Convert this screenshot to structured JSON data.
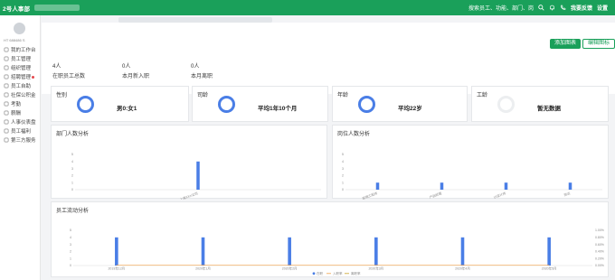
{
  "header": {
    "logo": "2号人事部",
    "search_text": "搜索员工、功能、部门、岗",
    "feedback": "我要反馈",
    "settings": "设置"
  },
  "sidebar": {
    "user_caption": "HT 688486 S",
    "items": [
      {
        "label": "我的工作台",
        "icon": "desk-icon"
      },
      {
        "label": "员工管理",
        "icon": "employee-icon"
      },
      {
        "label": "组织管理",
        "icon": "org-icon"
      },
      {
        "label": "招聘管理",
        "icon": "recruit-icon",
        "badge": true
      },
      {
        "label": "员工自助",
        "icon": "self-service-icon"
      },
      {
        "label": "社保公积金",
        "icon": "social-security-icon"
      },
      {
        "label": "考勤",
        "icon": "attendance-icon"
      },
      {
        "label": "薪酬",
        "icon": "salary-icon"
      },
      {
        "label": "人事仪表盘",
        "icon": "dashboard-icon"
      },
      {
        "label": "员工福利",
        "icon": "benefit-icon"
      },
      {
        "label": "第三方服务",
        "icon": "third-party-icon"
      }
    ]
  },
  "stats": [
    {
      "value": "4人",
      "label": "在职员工总数"
    },
    {
      "value": "0人",
      "label": "本月新入职"
    },
    {
      "value": "0人",
      "label": "本月离职"
    }
  ],
  "actions": {
    "add_chart": "添加图表",
    "edit_chart": "编辑图标"
  },
  "summary_cards": [
    {
      "title": "性别",
      "value": "男0:女1",
      "ring": "filled"
    },
    {
      "title": "司龄",
      "value": "平均1年10个月",
      "ring": "filled"
    },
    {
      "title": "年龄",
      "value": "平均22岁",
      "ring": "filled"
    },
    {
      "title": "工龄",
      "value": "暂无数据",
      "ring": "empty"
    }
  ],
  "colors": {
    "brand": "#1aa05a",
    "bar": "#4a7ee6",
    "line": "#f0a14a",
    "ring_empty": "#eceef0"
  },
  "chart_data": [
    {
      "type": "bar",
      "title": "部门人数分析",
      "categories": [
        "上海XXX公司"
      ],
      "values": [
        4
      ],
      "ylim": [
        0,
        5
      ],
      "yticks": [
        "0",
        "1",
        "2",
        "3",
        "4",
        "5"
      ],
      "grid": false
    },
    {
      "type": "bar",
      "title": "岗位人数分析",
      "categories": [
        "前端工程师",
        "产品经理",
        "UI设计师",
        "测试"
      ],
      "values": [
        1,
        1,
        1,
        1
      ],
      "ylim": [
        0,
        5
      ],
      "yticks": [
        "0",
        "1",
        "2",
        "3",
        "4",
        "5"
      ],
      "grid": false
    },
    {
      "type": "bar",
      "title": "员工流动分析",
      "categories": [
        "2019年12月",
        "2020年1月",
        "2020年2月",
        "2020年3月",
        "2020年4月",
        "2020年5月"
      ],
      "series": [
        {
          "name": "在职",
          "values": [
            4,
            4,
            4,
            4,
            4,
            4
          ]
        },
        {
          "name": "入职率",
          "values": [
            0,
            0,
            0,
            0,
            0,
            0
          ]
        },
        {
          "name": "离职率",
          "values": [
            0,
            0,
            0,
            0,
            0,
            0
          ]
        }
      ],
      "ylim": [
        0,
        5
      ],
      "yticks": [
        "0",
        "1",
        "2",
        "3",
        "4",
        "5"
      ],
      "y2ticks": [
        "0.00%",
        "0.20%",
        "0.40%",
        "0.60%",
        "0.80%",
        "1.00%"
      ],
      "legend": "bottom",
      "grid": false
    }
  ]
}
